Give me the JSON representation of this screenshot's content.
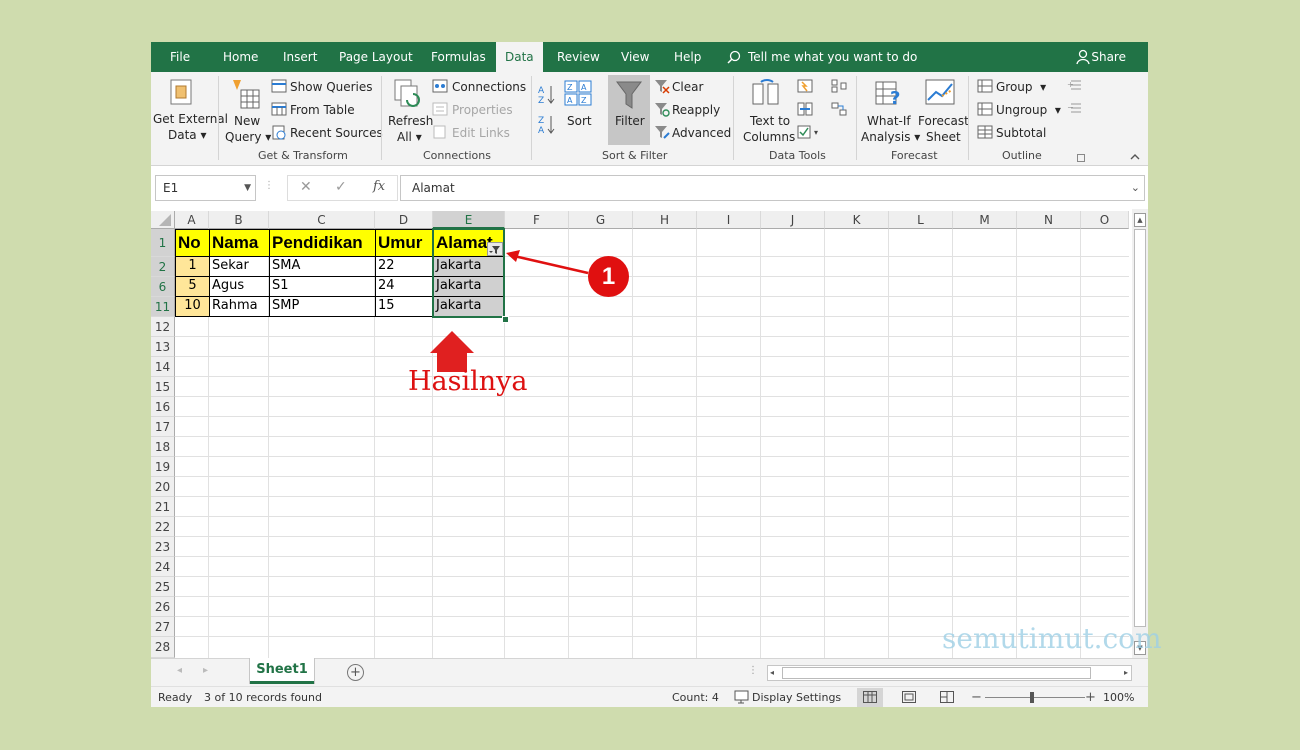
{
  "menu": {
    "tabs": [
      {
        "label": "File"
      },
      {
        "label": "Home"
      },
      {
        "label": "Insert"
      },
      {
        "label": "Page Layout"
      },
      {
        "label": "Formulas"
      },
      {
        "label": "Data"
      },
      {
        "label": "Review"
      },
      {
        "label": "View"
      },
      {
        "label": "Help"
      }
    ],
    "tell_me": "Tell me what you want to do",
    "share": "Share"
  },
  "ribbon": {
    "get_external_1": "Get External",
    "get_external_2": "Data",
    "new_query_1": "New",
    "new_query_2": "Query",
    "show_queries": "Show Queries",
    "from_table": "From Table",
    "recent_sources": "Recent Sources",
    "refresh_1": "Refresh",
    "refresh_2": "All",
    "connections": "Connections",
    "properties": "Properties",
    "edit_links": "Edit Links",
    "sort": "Sort",
    "filter": "Filter",
    "clear": "Clear",
    "reapply": "Reapply",
    "advanced": "Advanced",
    "text_to_1": "Text to",
    "text_to_2": "Columns",
    "whatif_1": "What-If",
    "whatif_2": "Analysis",
    "forecast_1": "Forecast",
    "forecast_2": "Sheet",
    "group": "Group",
    "ungroup": "Ungroup",
    "subtotal": "Subtotal",
    "groups": [
      "Get & Transform",
      "Connections",
      "Sort & Filter",
      "Data Tools",
      "Forecast",
      "Outline"
    ]
  },
  "formula_bar": {
    "name_box": "E1",
    "fx": "fx",
    "value": "Alamat"
  },
  "sheet": {
    "columns": [
      "A",
      "B",
      "C",
      "D",
      "E",
      "F",
      "G",
      "H",
      "I",
      "J",
      "K",
      "L",
      "M",
      "N",
      "O"
    ],
    "rows": [
      "1",
      "2",
      "6",
      "11",
      "12",
      "13",
      "14",
      "15",
      "16",
      "17",
      "18",
      "19",
      "20",
      "21",
      "22",
      "23",
      "24",
      "25",
      "26",
      "27",
      "28"
    ],
    "header": [
      "No",
      "Nama",
      "Pendidikan",
      "Umur",
      "Alamat"
    ],
    "records": [
      [
        "1",
        "Sekar",
        "SMA",
        "22",
        "Jakarta"
      ],
      [
        "5",
        "Agus",
        "S1",
        "24",
        "Jakarta"
      ],
      [
        "10",
        "Rahma",
        "SMP",
        "15",
        "Jakarta"
      ]
    ]
  },
  "sheet_tab": "Sheet1",
  "status": {
    "ready": "Ready",
    "records_found": "3 of 10 records found",
    "count": "Count: 4",
    "display_settings": "Display Settings",
    "zoom": "100%"
  },
  "annotations": {
    "badge": "1",
    "label": "Hasilnya",
    "watermark": "semutimut.com"
  },
  "colors": {
    "excel_green": "#217346",
    "header_fill": "#ffff00",
    "annotation_red": "#e01010"
  }
}
